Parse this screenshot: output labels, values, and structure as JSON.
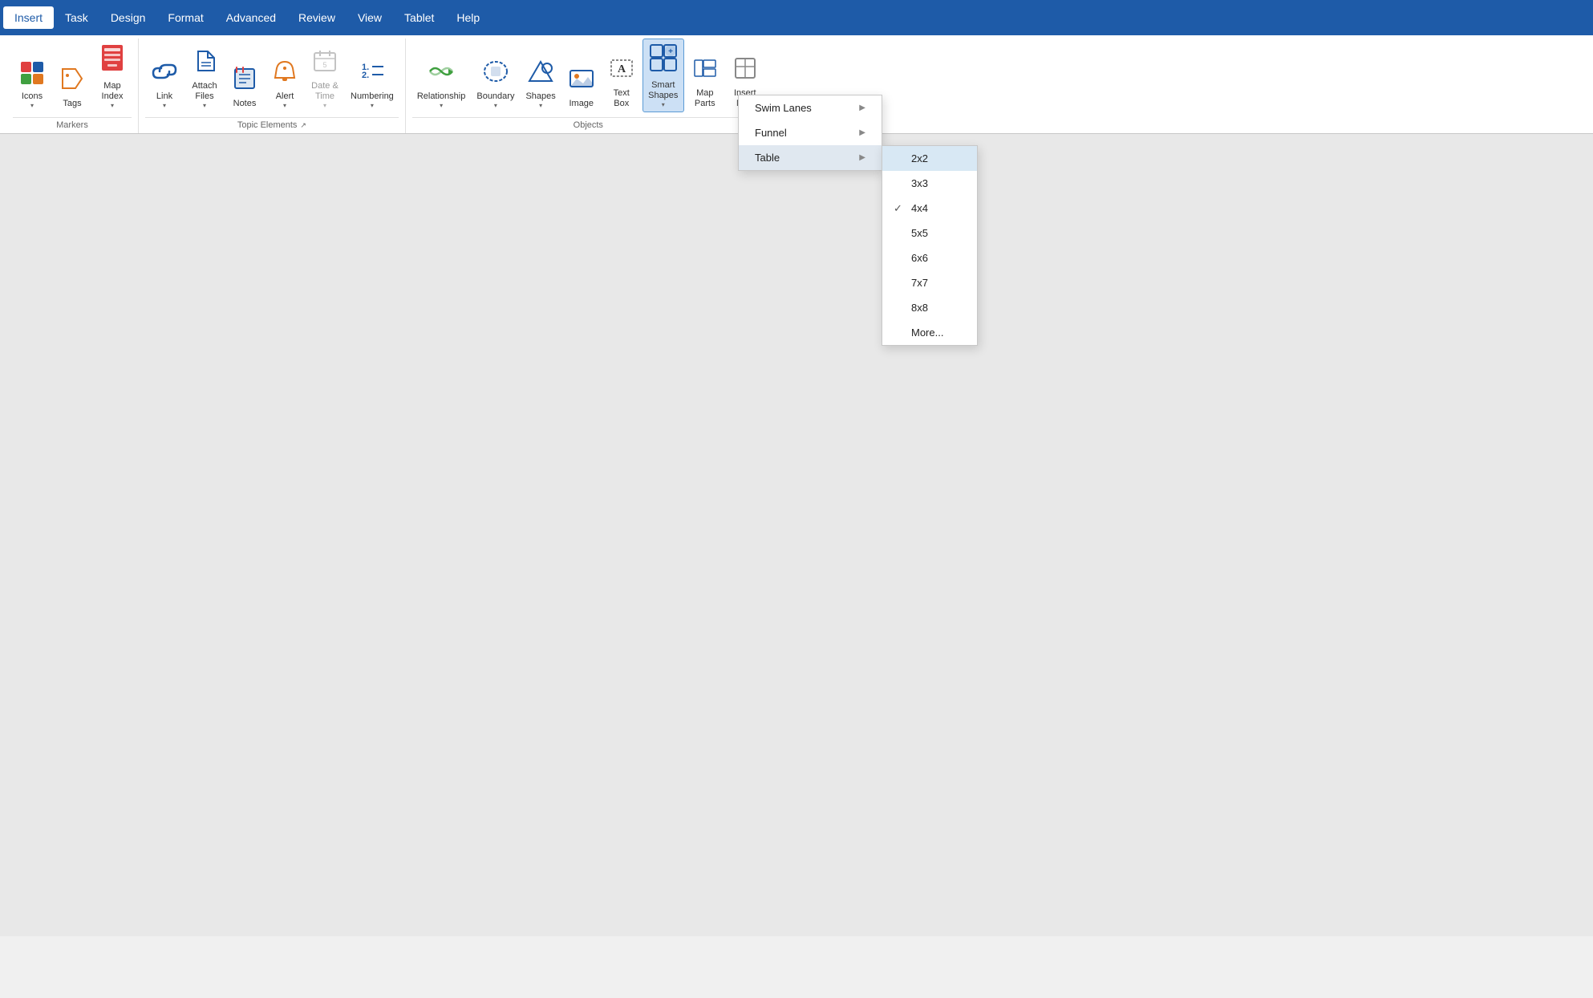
{
  "menubar": {
    "items": [
      {
        "label": "Insert",
        "active": true
      },
      {
        "label": "Task"
      },
      {
        "label": "Design"
      },
      {
        "label": "Format"
      },
      {
        "label": "Advanced"
      },
      {
        "label": "Review"
      },
      {
        "label": "View"
      },
      {
        "label": "Tablet"
      },
      {
        "label": "Help"
      }
    ]
  },
  "ribbon": {
    "groups": [
      {
        "name": "markers",
        "label": "Markers",
        "items": [
          {
            "id": "icons",
            "label": "Icons",
            "icon": "🏷",
            "dropdown": true
          },
          {
            "id": "tags",
            "label": "Tags",
            "icon": "🔖",
            "dropdown": false
          },
          {
            "id": "map-index",
            "label": "Map\nIndex",
            "icon": "📋",
            "dropdown": true
          }
        ]
      },
      {
        "name": "topic-elements",
        "label": "Topic Elements",
        "items": [
          {
            "id": "link",
            "label": "Link",
            "icon": "🔗",
            "dropdown": true
          },
          {
            "id": "attach-files",
            "label": "Attach\nFiles",
            "icon": "📎",
            "dropdown": true
          },
          {
            "id": "notes",
            "label": "Notes",
            "icon": "📝",
            "dropdown": false
          },
          {
            "id": "alert",
            "label": "Alert",
            "icon": "🔔",
            "dropdown": true
          },
          {
            "id": "date-time",
            "label": "Date &\nTime",
            "icon": "📅",
            "dropdown": true,
            "disabled": true
          },
          {
            "id": "numbering",
            "label": "Numbering",
            "icon": "🔢",
            "dropdown": true
          }
        ]
      },
      {
        "name": "objects",
        "label": "Objects",
        "items": [
          {
            "id": "relationship",
            "label": "Relationship",
            "icon": "↔",
            "dropdown": true
          },
          {
            "id": "boundary",
            "label": "Boundary",
            "icon": "⬡",
            "dropdown": true
          },
          {
            "id": "shapes",
            "label": "Shapes",
            "icon": "⬢",
            "dropdown": true
          },
          {
            "id": "image",
            "label": "Image",
            "icon": "🖼",
            "dropdown": false
          },
          {
            "id": "text-box",
            "label": "Text\nBox",
            "icon": "⬜",
            "dropdown": false
          },
          {
            "id": "smart-shapes",
            "label": "Smart\nShapes",
            "icon": "⊞",
            "dropdown": true,
            "active": true
          },
          {
            "id": "map-parts",
            "label": "Map\nParts",
            "icon": "🗺",
            "dropdown": false
          },
          {
            "id": "insert-map",
            "label": "Insert\nMap",
            "icon": "📄",
            "dropdown": false
          }
        ]
      }
    ]
  },
  "smart_shapes_menu": {
    "items": [
      {
        "id": "swim-lanes",
        "label": "Swim Lanes",
        "hasSubmenu": true
      },
      {
        "id": "funnel",
        "label": "Funnel",
        "hasSubmenu": true
      },
      {
        "id": "table",
        "label": "Table",
        "hasSubmenu": true,
        "highlighted": true
      }
    ]
  },
  "table_submenu": {
    "items": [
      {
        "id": "2x2",
        "label": "2x2",
        "check": "",
        "highlighted": true
      },
      {
        "id": "3x3",
        "label": "3x3",
        "check": ""
      },
      {
        "id": "4x4",
        "label": "4x4",
        "check": "✓"
      },
      {
        "id": "5x5",
        "label": "5x5",
        "check": ""
      },
      {
        "id": "6x6",
        "label": "6x6",
        "check": ""
      },
      {
        "id": "7x7",
        "label": "7x7",
        "check": ""
      },
      {
        "id": "8x8",
        "label": "8x8",
        "check": ""
      },
      {
        "id": "more",
        "label": "More...",
        "check": ""
      }
    ]
  }
}
